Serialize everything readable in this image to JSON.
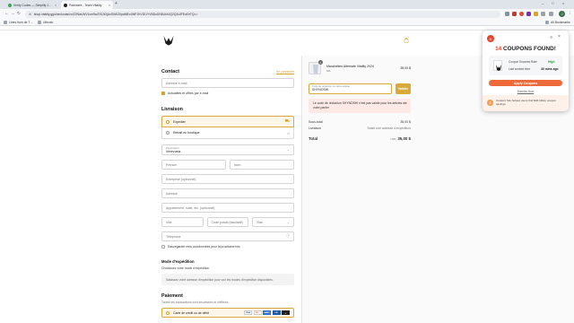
{
  "browser": {
    "tabs": [
      {
        "title": "Verify Codes — Simplify J…",
        "active": false
      },
      {
        "title": "Paiement - Team Vitality",
        "active": true
      }
    ],
    "url": "shop.vitality.gg/checkouts/cn/Z2NwLWV1cm9wZS13OjAxSlhEZ0paMEo0MFJKVDI1YVBDcDN5UkhJQ2Q4UlFEcElrTQ==",
    "bookmarks": [
      "Lines from de T…",
      "Ulbcolo"
    ],
    "all_bookmarks": "All Bookmarks",
    "profile_initial": "J",
    "colors": {
      "tab_bar": "#dfe3ea",
      "toolbar": "#f7f8fa"
    }
  },
  "header": {
    "logo": "vitality-wasp-logo-icon",
    "cart_icon": "shopping-bag-icon"
  },
  "contact": {
    "title": "Contact",
    "login_link": "Se connecter",
    "email_placeholder": "Adresse e-mail",
    "newsletter_label": "Actualités et offres par e-mail"
  },
  "delivery": {
    "title": "Livraison",
    "options": [
      {
        "label": "Expédier",
        "selected": true,
        "icon": "truck-icon"
      },
      {
        "label": "Retrait en boutique",
        "selected": false,
        "icon": "store-icon"
      }
    ],
    "region_label": "Pays/région",
    "region_value": "Venezuela",
    "firstname_placeholder": "Prénom",
    "lastname_placeholder": "Nom",
    "company_placeholder": "Entreprise (optionnel)",
    "address_placeholder": "Adresse",
    "apartment_placeholder": "Appartement, suite, etc. (optionnel)",
    "city_placeholder": "Ville",
    "postal_placeholder": "Code postal (facultatif)",
    "state_placeholder": "État",
    "phone_placeholder": "Téléphone",
    "save_info_label": "Sauvegarder mes coordonnées pour la prochaine fois"
  },
  "shipping_method": {
    "title": "Mode d'expédition",
    "subtitle": "Choisissez votre mode d'expédition",
    "notice": "Saisissez votre adresse d'expédition pour voir les modes d'expédition disponibles."
  },
  "payment": {
    "title": "Paiement",
    "subtitle": "Toutes les transactions sont sécurisées et chiffrées.",
    "method_label": "Carte de crédit ou de débit",
    "cards": [
      "VISA",
      "MC",
      "AMEX",
      "CB",
      "+"
    ]
  },
  "summary": {
    "product": {
      "name": "Manchettes Alternate Vitality 2024",
      "variant": "M/L",
      "price": "35,00 $",
      "quantity": "1"
    },
    "coupon_label": "Code de réduction ou carte-cadeau",
    "coupon_value": "SHYNOSHI",
    "apply_label": "Valider",
    "error_message": "Le code de réduction SHYNOSHI n'est pas valide pour les articles de votre panier",
    "subtotal_label": "Sous-total",
    "subtotal_value": "35,00 $",
    "shipping_label": "Livraison",
    "shipping_value": "Saisir une adresse d'expédition",
    "total_label": "Total",
    "total_currency": "USD",
    "total_value": "35,00 $"
  },
  "popup": {
    "count": "14",
    "title_suffix": "COUPONS FOUND!",
    "success_label": "Coupon Success Rate",
    "success_value": "High",
    "last_worked_label": "Last worked time",
    "last_worked_value": "40 mins ago",
    "apply_label": "Apply Coupons",
    "dismiss_label": "Dismiss Now",
    "footer_text": "Coupert has helped users find $46 billion coupon savings.",
    "colors": {
      "accent": "#e6452c",
      "button": "#ef6a3a"
    }
  }
}
